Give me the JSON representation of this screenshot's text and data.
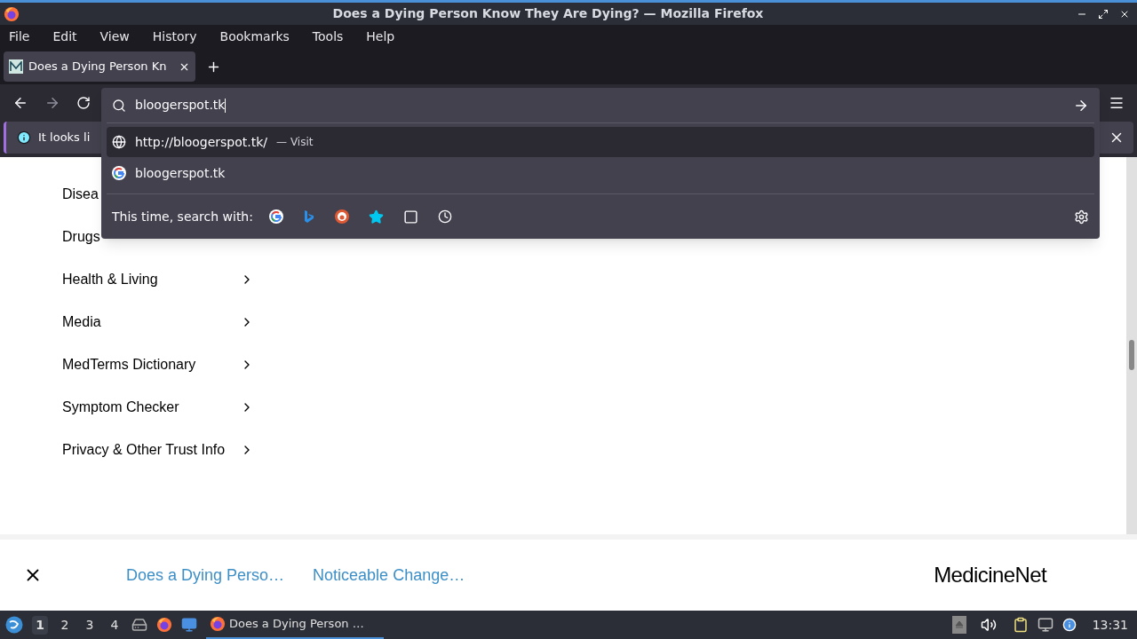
{
  "window": {
    "title": "Does a Dying Person Know They Are Dying? — Mozilla Firefox"
  },
  "menu": [
    "File",
    "Edit",
    "View",
    "History",
    "Bookmarks",
    "Tools",
    "Help"
  ],
  "tabs": [
    {
      "label": "Does a Dying Person Kn",
      "selected": true
    }
  ],
  "notification": {
    "text": "It looks li"
  },
  "urlbar": {
    "value": "bloogerspot.tk"
  },
  "suggestions": [
    {
      "kind": "visit",
      "text": "http://bloogerspot.tk/",
      "action": "— Visit",
      "selected": true
    },
    {
      "kind": "search",
      "text": "bloogerspot.tk",
      "selected": false
    }
  ],
  "search_with": {
    "label": "This time, search with:"
  },
  "sidebar": [
    {
      "label": "Disea"
    },
    {
      "label": "Drugs"
    },
    {
      "label": "Health & Living",
      "arrow": true
    },
    {
      "label": "Media",
      "arrow": true
    },
    {
      "label": "MedTerms Dictionary",
      "arrow": true
    },
    {
      "label": "Symptom Checker",
      "arrow": true
    },
    {
      "label": "Privacy & Other Trust Info",
      "arrow": true
    }
  ],
  "footer": {
    "links": [
      "Does a Dying Perso…",
      "Noticeable Change…"
    ],
    "logo": "MedicineNet"
  },
  "taskbar": {
    "workspaces": [
      {
        "label": "1",
        "selected": true
      },
      {
        "label": "2",
        "selected": false
      },
      {
        "label": "3",
        "selected": false
      },
      {
        "label": "4",
        "selected": false
      }
    ],
    "task": "Does a Dying Person …",
    "clock": "13:31"
  }
}
